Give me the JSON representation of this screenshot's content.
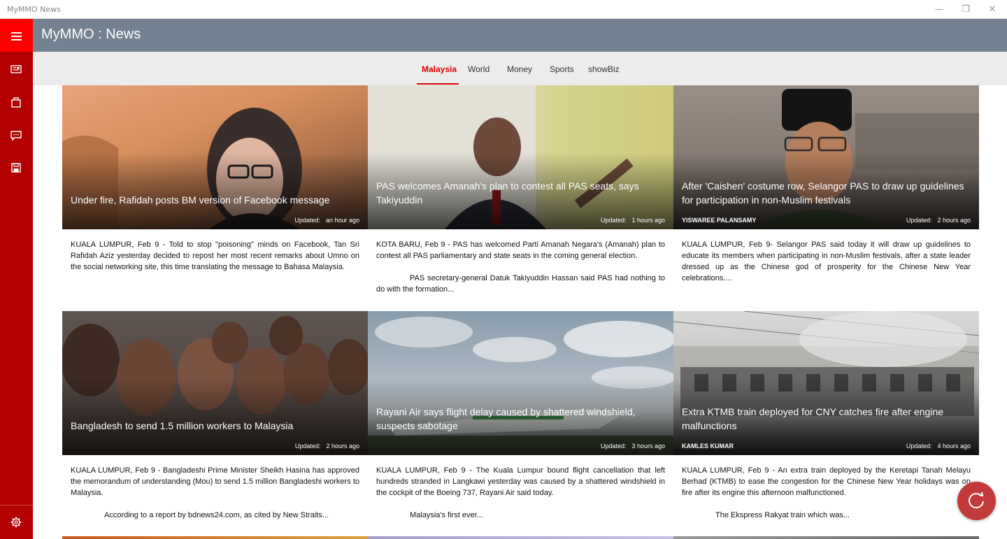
{
  "window": {
    "title": "MyMMO News"
  },
  "app": {
    "title": "MyMMO : News"
  },
  "tabs": [
    {
      "label": "Malaysia",
      "active": true
    },
    {
      "label": "World",
      "active": false
    },
    {
      "label": "Money",
      "active": false
    },
    {
      "label": "Sports",
      "active": false
    },
    {
      "label": "showBiz",
      "active": false
    }
  ],
  "sidebar": {
    "items": [
      {
        "icon": "newspaper-icon"
      },
      {
        "icon": "bag-icon"
      },
      {
        "icon": "chat-icon"
      },
      {
        "icon": "save-icon"
      }
    ],
    "footer_icon": "gear-icon"
  },
  "articles": [
    {
      "headline": "Under fire, Rafidah posts BM version of Facebook message",
      "author": "",
      "updated_label": "Updated:",
      "updated": "an hour ago",
      "summary": "KUALA LUMPUR, Feb 9 - Told to stop \"poisoning\" minds on Facebook, Tan Sri Rafidah Aziz yesterday decided to repost her most recent remarks about Umno on the social networking site, this time translating the message to Bahasa Malaysia.",
      "summary2": ""
    },
    {
      "headline": "PAS welcomes Amanah's plan to contest all PAS seats, says Takiyuddin",
      "author": "",
      "updated_label": "Updated:",
      "updated": "1 hours ago",
      "summary": "KOTA BARU, Feb 9 - PAS has welcomed Parti Amanah Negara's (Amanah) plan to contest all PAS parliamentary and state seats in the coming general election.",
      "summary2": "PAS secretary-general Datuk Takiyuddin Hassan said PAS had nothing to do with the formation..."
    },
    {
      "headline": "After 'Caishen' costume row, Selangor PAS to draw up guidelines for participation in non-Muslim festivals",
      "author": "YISWAREE PALANSAMY",
      "updated_label": "Updated:",
      "updated": "2 hours ago",
      "summary": "KUALA LUMPUR, Feb 9- Selangor PAS said today it will draw up guidelines to educate its members when participating in non-Muslim festivals, after a state leader dressed up as the Chinese god of prosperity for the Chinese New Year celebrations....",
      "summary2": ""
    },
    {
      "headline": "Bangladesh to send 1.5 million workers to Malaysia",
      "author": "",
      "updated_label": "Updated:",
      "updated": "2 hours ago",
      "summary": "KUALA LUMPUR, Feb 9 - Bangladeshi Prime Minister Sheikh Hasina has approved the memorandum of understanding (Mou) to send 1.5 million Bangladeshi workers to Malaysia.",
      "summary2": "According to a report by bdnews24.com, as cited by New Straits..."
    },
    {
      "headline": "Rayani Air says flight delay caused by shattered windshield, suspects sabotage",
      "author": "",
      "updated_label": "Updated:",
      "updated": "3 hours ago",
      "summary": "KUALA LUMPUR, Feb 9 - The Kuala Lumpur bound flight cancellation that left hundreds stranded in Langkawi yesterday was caused by a shattered windshield in the cockpit of the Boeing 737, Rayani Air said today.",
      "summary2": "Malaysia's first ever..."
    },
    {
      "headline": "Extra KTMB train deployed for CNY catches fire after engine malfunctions",
      "author": "KAMLES KUMAR",
      "updated_label": "Updated:",
      "updated": "4 hours ago",
      "summary": "KUALA LUMPUR, Feb 9 - An extra train deployed by the Keretapi Tanah Melayu Berhad (KTMB) to ease the congestion for the Chinese New Year holidays was on fire after its engine this afternoon malfunctioned.",
      "summary2": "The Ekspress Rakyat train which was..."
    }
  ],
  "colors": {
    "sidebar": "#b30000",
    "hamburger": "#ff0000",
    "appbar": "#738190",
    "accent": "#e00000",
    "fab": "#c23a3a"
  },
  "fab": {
    "icon": "refresh-icon"
  }
}
